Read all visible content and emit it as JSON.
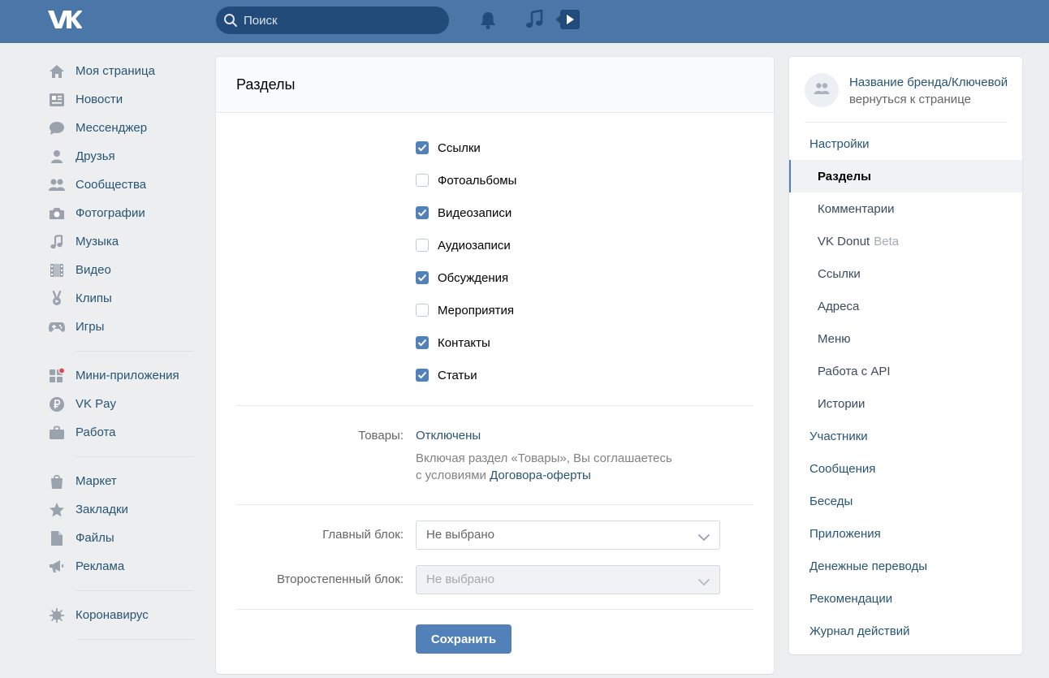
{
  "header": {
    "logo_icon": "vk-logo-icon",
    "search_placeholder": "Поиск",
    "icons": [
      "bell-icon",
      "music-note-icon",
      "play-video-icon"
    ]
  },
  "leftnav": {
    "items": [
      {
        "label": "Моя страница",
        "icon": "home-icon"
      },
      {
        "label": "Новости",
        "icon": "news-icon"
      },
      {
        "label": "Мессенджер",
        "icon": "messenger-icon"
      },
      {
        "label": "Друзья",
        "icon": "friends-icon"
      },
      {
        "label": "Сообщества",
        "icon": "communities-icon"
      },
      {
        "label": "Фотографии",
        "icon": "camera-icon"
      },
      {
        "label": "Музыка",
        "icon": "music-icon"
      },
      {
        "label": "Видео",
        "icon": "film-icon"
      },
      {
        "label": "Клипы",
        "icon": "clips-icon"
      },
      {
        "label": "Игры",
        "icon": "gamepad-icon"
      },
      {
        "label": "Мини-приложения",
        "icon": "mini-apps-icon"
      },
      {
        "label": "VK Pay",
        "icon": "ruble-icon"
      },
      {
        "label": "Работа",
        "icon": "briefcase-icon"
      },
      {
        "label": "Маркет",
        "icon": "shopping-bag-icon"
      },
      {
        "label": "Закладки",
        "icon": "star-icon"
      },
      {
        "label": "Файлы",
        "icon": "file-icon"
      },
      {
        "label": "Реклама",
        "icon": "megaphone-icon"
      },
      {
        "label": "Коронавирус",
        "icon": "virus-icon"
      }
    ]
  },
  "main": {
    "title": "Разделы",
    "sections": [
      {
        "label": "Ссылки",
        "checked": true
      },
      {
        "label": "Фотоальбомы",
        "checked": false
      },
      {
        "label": "Видеозаписи",
        "checked": true
      },
      {
        "label": "Аудиозаписи",
        "checked": false
      },
      {
        "label": "Обсуждения",
        "checked": true
      },
      {
        "label": "Мероприятия",
        "checked": false
      },
      {
        "label": "Контакты",
        "checked": true
      },
      {
        "label": "Статьи",
        "checked": true
      }
    ],
    "goods": {
      "label": "Товары:",
      "value": "Отключены",
      "note_line1": "Включая раздел «Товары», Вы соглашаетесь",
      "note_line2_prefix": "с условиями",
      "note_link": "Договора-оферты"
    },
    "main_block": {
      "label": "Главный блок:",
      "value": "Не выбрано"
    },
    "secondary_block": {
      "label": "Второстепенный блок:",
      "value": "Не выбрано"
    },
    "save_label": "Сохранить"
  },
  "sidebar": {
    "group_name": "Название бренда/Ключевой запрос",
    "back_label": "вернуться к странице",
    "menu": [
      {
        "label": "Настройки",
        "level": "top"
      },
      {
        "label": "Разделы",
        "level": "sub",
        "active": true
      },
      {
        "label": "Комментарии",
        "level": "sub"
      },
      {
        "label": "VK Donut",
        "level": "sub",
        "badge": "Beta"
      },
      {
        "label": "Ссылки",
        "level": "sub"
      },
      {
        "label": "Адреса",
        "level": "sub"
      },
      {
        "label": "Меню",
        "level": "sub"
      },
      {
        "label": "Работа с API",
        "level": "sub"
      },
      {
        "label": "Истории",
        "level": "sub"
      },
      {
        "label": "Участники",
        "level": "top"
      },
      {
        "label": "Сообщения",
        "level": "top"
      },
      {
        "label": "Беседы",
        "level": "top"
      },
      {
        "label": "Приложения",
        "level": "top"
      },
      {
        "label": "Денежные переводы",
        "level": "top"
      },
      {
        "label": "Рекомендации",
        "level": "top"
      },
      {
        "label": "Журнал действий",
        "level": "top"
      }
    ]
  },
  "colors": {
    "header_bg": "#4a76a8",
    "accent": "#5181b8",
    "link": "#285473",
    "page_bg": "#edeef0",
    "notification_dot": "#e64646"
  }
}
